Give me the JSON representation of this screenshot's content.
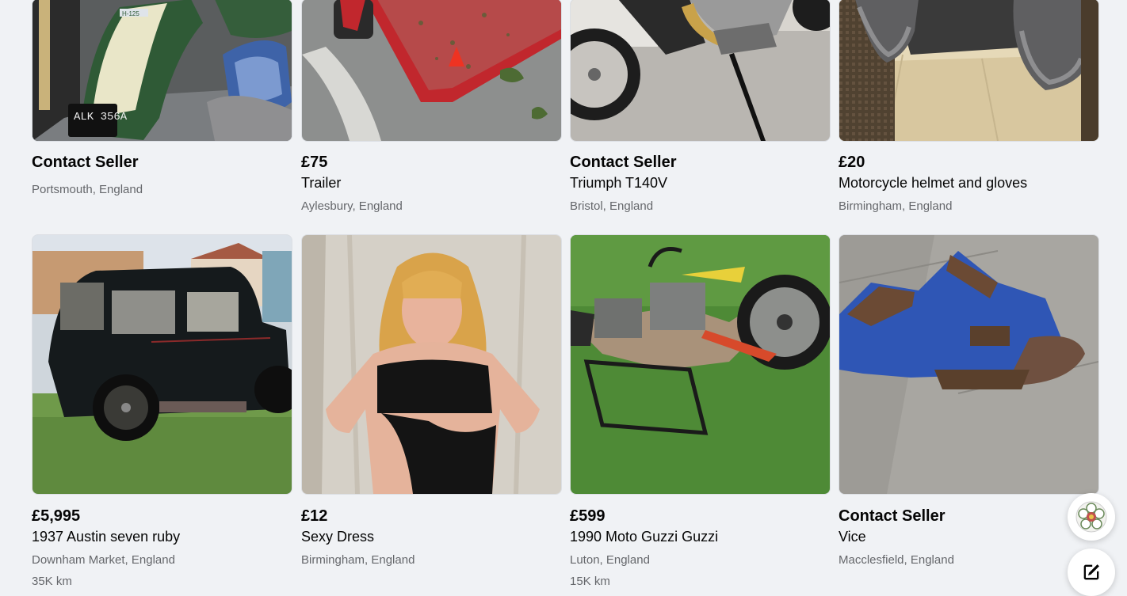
{
  "listings": [
    {
      "price": "Contact Seller",
      "title": "",
      "location": "Portsmouth, England",
      "meta": ""
    },
    {
      "price": "£75",
      "title": "Trailer",
      "location": "Aylesbury, England",
      "meta": ""
    },
    {
      "price": "Contact Seller",
      "title": "Triumph T140V",
      "location": "Bristol, England",
      "meta": ""
    },
    {
      "price": "£20",
      "title": "Motorcycle helmet and gloves",
      "location": "Birmingham, England",
      "meta": ""
    },
    {
      "price": "£5,995",
      "title": "1937 Austin seven ruby",
      "location": "Downham Market, England",
      "meta": "35K km"
    },
    {
      "price": "£12",
      "title": "Sexy Dress",
      "location": "Birmingham, England",
      "meta": ""
    },
    {
      "price": "£599",
      "title": "1990 Moto Guzzi Guzzi",
      "location": "Luton, England",
      "meta": "15K km"
    },
    {
      "price": "Contact Seller",
      "title": "Vice",
      "location": "Macclesfield, England",
      "meta": ""
    }
  ],
  "photos": [
    {
      "plate": "ALK 356A",
      "badge": "H-125"
    },
    {
      "plate": ""
    },
    {
      "plate": ""
    },
    {
      "plate": ""
    },
    {
      "plate": ""
    },
    {
      "plate": ""
    },
    {
      "plate": ""
    },
    {
      "plate": ""
    }
  ],
  "floating_buttons": [
    {
      "icon": "rose-avatar-icon"
    },
    {
      "icon": "compose-icon"
    }
  ]
}
